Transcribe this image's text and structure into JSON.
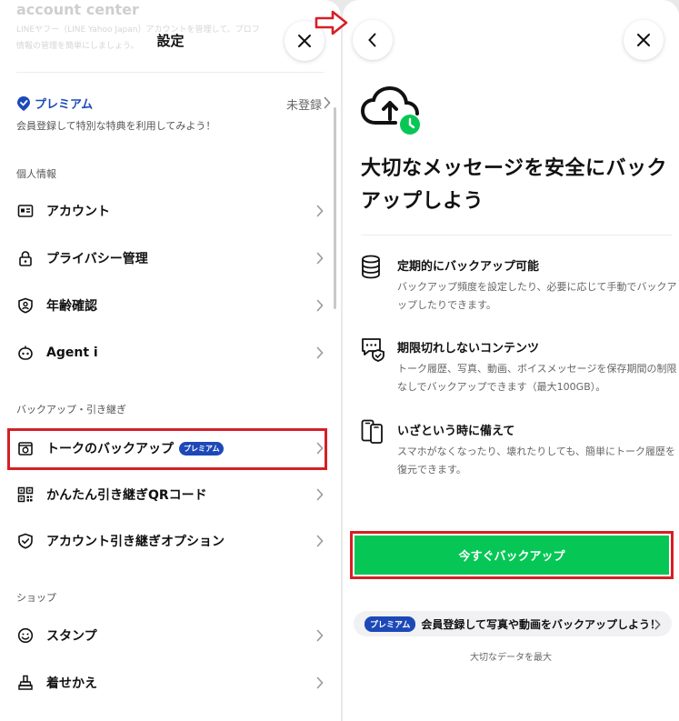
{
  "left": {
    "ghost_title": "account center",
    "ghost_line1": "LINEヤフー（LINE Yahoo Japan）アカウントを管理して、プロフ",
    "ghost_line2": "情報の管理を簡単にしましょう。",
    "title": "設定",
    "premium": {
      "logo_text": "プレミアム",
      "status": "未登録",
      "description": "会員登録して特別な特典を利用してみよう！"
    },
    "sections": [
      {
        "label": "個人情報",
        "items": [
          {
            "label": "アカウント",
            "icon": "id-card-icon"
          },
          {
            "label": "プライバシー管理",
            "icon": "lock-icon"
          },
          {
            "label": "年齢確認",
            "icon": "shield-check-icon"
          },
          {
            "label": "Agent i",
            "icon": "robot-icon"
          }
        ]
      },
      {
        "label": "バックアップ・引き継ぎ",
        "items": [
          {
            "label": "トークのバックアップ",
            "icon": "backup-icon",
            "badge": "プレミアム"
          },
          {
            "label": "かんたん引き継ぎQRコード",
            "icon": "qr-code-icon"
          },
          {
            "label": "アカウント引き継ぎオプション",
            "icon": "shield-check-icon"
          }
        ]
      },
      {
        "label": "ショップ",
        "items": [
          {
            "label": "スタンプ",
            "icon": "smiley-icon"
          },
          {
            "label": "着せかえ",
            "icon": "brush-icon"
          }
        ]
      }
    ]
  },
  "right": {
    "hero_title": "大切なメッセージを安全にバックアップしよう",
    "features": [
      {
        "title": "定期的にバックアップ可能",
        "description": "バックアップ頻度を設定したり、必要に応じて手動でバックアップしたりできます。",
        "icon": "database-icon"
      },
      {
        "title": "期限切れしないコンテンツ",
        "description": "トーク履歴、写真、動画、ボイスメッセージを保存期間の制限なしでバックアップできます（最大100GB）。",
        "icon": "chat-shield-icon"
      },
      {
        "title": "いざという時に備えて",
        "description": "スマホがなくなったり、壊れたりしても、簡単にトーク履歴を復元できます。",
        "icon": "phones-icon"
      }
    ],
    "cta_label": "今すぐバックアップ",
    "promo": {
      "badge": "プレミアム",
      "text": "会員登録して写真や動画をバックアップしよう！"
    },
    "footnote": "大切なデータを最大"
  },
  "colors": {
    "accent_green": "#06c755",
    "premium_blue": "#1d49b8",
    "highlight_red": "#d61f26"
  }
}
